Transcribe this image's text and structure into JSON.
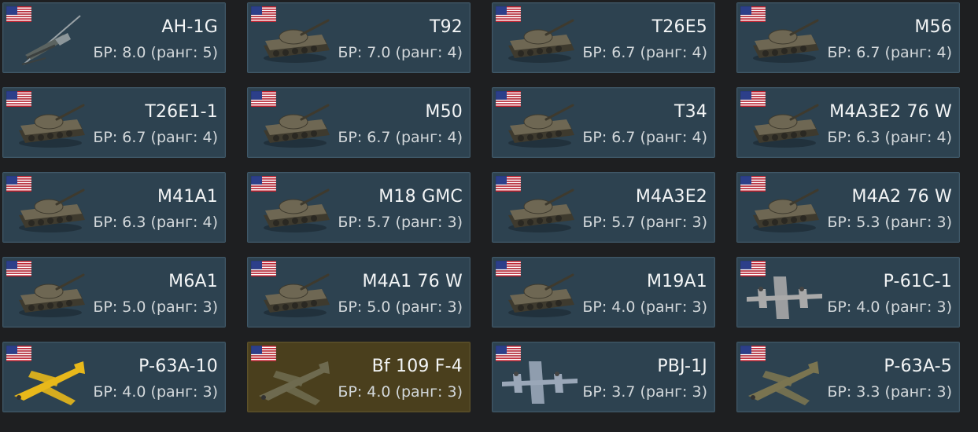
{
  "nation": "usa",
  "vehicles": [
    {
      "name": "AH-1G",
      "br": "БР: 8.0 (ранг: 5)",
      "type": "helicopter-icon",
      "premium": false
    },
    {
      "name": "T92",
      "br": "БР: 7.0 (ранг: 4)",
      "type": "tank-icon",
      "premium": false
    },
    {
      "name": "T26E5",
      "br": "БР: 6.7 (ранг: 4)",
      "type": "tank-icon",
      "premium": false
    },
    {
      "name": "M56",
      "br": "БР: 6.7 (ранг: 4)",
      "type": "tank-icon",
      "premium": false
    },
    {
      "name": "T26E1-1",
      "br": "БР: 6.7 (ранг: 4)",
      "type": "tank-icon",
      "premium": false
    },
    {
      "name": "M50",
      "br": "БР: 6.7 (ранг: 4)",
      "type": "tank-icon",
      "premium": false
    },
    {
      "name": "T34",
      "br": "БР: 6.7 (ранг: 4)",
      "type": "tank-icon",
      "premium": false
    },
    {
      "name": "M4A3E2 76 W",
      "br": "БР: 6.3 (ранг: 4)",
      "type": "tank-icon",
      "premium": false
    },
    {
      "name": "M41A1",
      "br": "БР: 6.3 (ранг: 4)",
      "type": "tank-icon",
      "premium": false
    },
    {
      "name": "M18 GMC",
      "br": "БР: 5.7 (ранг: 3)",
      "type": "tank-icon",
      "premium": false
    },
    {
      "name": "M4A3E2",
      "br": "БР: 5.7 (ранг: 3)",
      "type": "tank-icon",
      "premium": false
    },
    {
      "name": "M4A2 76 W",
      "br": "БР: 5.3 (ранг: 3)",
      "type": "tank-icon",
      "premium": false
    },
    {
      "name": "M6A1",
      "br": "БР: 5.0 (ранг: 3)",
      "type": "tank-icon",
      "premium": false
    },
    {
      "name": "M4A1 76 W",
      "br": "БР: 5.0 (ранг: 3)",
      "type": "tank-icon",
      "premium": false
    },
    {
      "name": "M19A1",
      "br": "БР: 4.0 (ранг: 3)",
      "type": "tank-icon",
      "premium": false
    },
    {
      "name": "P-61C-1",
      "br": "БР: 4.0 (ранг: 3)",
      "type": "twin-plane-icon",
      "premium": false
    },
    {
      "name": "P-63A-10",
      "br": "БР: 4.0 (ранг: 3)",
      "type": "plane-icon",
      "premium": false,
      "color": "#e8b81a"
    },
    {
      "name": "Bf 109 F-4",
      "br": "БР: 4.0 (ранг: 3)",
      "type": "plane-icon",
      "premium": true,
      "color": "#6e6a4f"
    },
    {
      "name": "PBJ-1J",
      "br": "БР: 3.7 (ранг: 3)",
      "type": "twin-plane-icon",
      "premium": false,
      "color": "#9aa7b8"
    },
    {
      "name": "P-63A-5",
      "br": "БР: 3.3 (ранг: 3)",
      "type": "plane-icon",
      "premium": false,
      "color": "#7a7450"
    }
  ],
  "colors": {
    "card_bg": "#2d4250",
    "card_border": "#3f5868",
    "premium_bg": "#4a3f1d",
    "tank": "#6e6753",
    "tank_dark": "#3e3a2e"
  }
}
